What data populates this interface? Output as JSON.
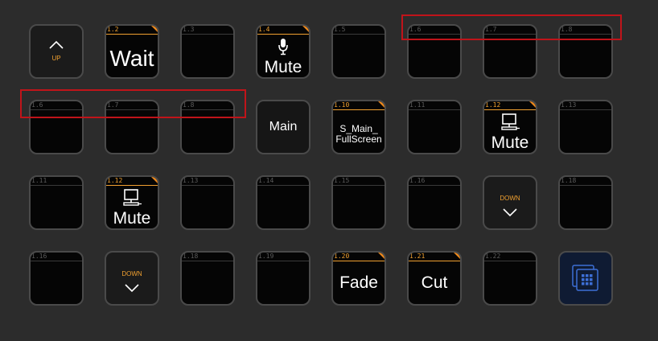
{
  "keys": [
    {
      "row": 0,
      "col": 0,
      "type": "nav",
      "dir": "up",
      "text": "UP"
    },
    {
      "row": 0,
      "col": 1,
      "id": "1.2",
      "active": true,
      "big": "Wait"
    },
    {
      "row": 0,
      "col": 2,
      "id": "1.3"
    },
    {
      "row": 0,
      "col": 3,
      "id": "1.4",
      "active": true,
      "icon": "microphone-icon",
      "mid": "Mute"
    },
    {
      "row": 0,
      "col": 4,
      "id": "1.5"
    },
    {
      "row": 0,
      "col": 5,
      "id": "1.6"
    },
    {
      "row": 0,
      "col": 6,
      "id": "1.7"
    },
    {
      "row": 0,
      "col": 7,
      "id": "1.8"
    },
    {
      "row": 1,
      "col": 0,
      "id": "1.6"
    },
    {
      "row": 1,
      "col": 1,
      "id": "1.7"
    },
    {
      "row": 1,
      "col": 2,
      "id": "1.8"
    },
    {
      "row": 1,
      "col": 3,
      "type": "label",
      "center": "Main"
    },
    {
      "row": 1,
      "col": 4,
      "id": "1.10",
      "active": true,
      "small2": [
        "S_Main_",
        "FullScreen"
      ]
    },
    {
      "row": 1,
      "col": 5,
      "id": "1.11"
    },
    {
      "row": 1,
      "col": 6,
      "id": "1.12",
      "active": true,
      "icon": "computer-icon",
      "mid": "Mute"
    },
    {
      "row": 1,
      "col": 7,
      "id": "1.13"
    },
    {
      "row": 2,
      "col": 0,
      "id": "1.11"
    },
    {
      "row": 2,
      "col": 1,
      "id": "1.12",
      "active": true,
      "icon": "computer-icon",
      "mid": "Mute"
    },
    {
      "row": 2,
      "col": 2,
      "id": "1.13"
    },
    {
      "row": 2,
      "col": 3,
      "id": "1.14"
    },
    {
      "row": 2,
      "col": 4,
      "id": "1.15"
    },
    {
      "row": 2,
      "col": 5,
      "id": "1.16"
    },
    {
      "row": 2,
      "col": 6,
      "type": "nav",
      "dir": "down",
      "text": "DOWN"
    },
    {
      "row": 2,
      "col": 7,
      "id": "1.18"
    },
    {
      "row": 3,
      "col": 0,
      "id": "1.16"
    },
    {
      "row": 3,
      "col": 1,
      "type": "nav",
      "dir": "down",
      "text": "DOWN"
    },
    {
      "row": 3,
      "col": 2,
      "id": "1.18"
    },
    {
      "row": 3,
      "col": 3,
      "id": "1.19"
    },
    {
      "row": 3,
      "col": 4,
      "id": "1.20",
      "active": true,
      "mid2": "Fade"
    },
    {
      "row": 3,
      "col": 5,
      "id": "1.21",
      "active": true,
      "mid2": "Cut"
    },
    {
      "row": 3,
      "col": 6,
      "id": "1.22"
    },
    {
      "row": 3,
      "col": 7,
      "type": "grid"
    }
  ],
  "colors": {
    "accent": "#f0a030",
    "highlight": "#c0141a",
    "grid_button": "#3d6fd6"
  }
}
